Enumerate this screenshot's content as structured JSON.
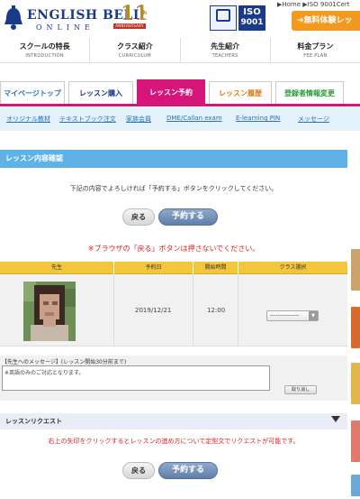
{
  "header": {
    "logo_text": "ENGLISH BELL",
    "logo_sub": "ONLINE",
    "anniversary_num": "11",
    "anniversary_suffix": "th",
    "anniversary_band": "ANNIVERSARY",
    "iso_label": "ISO",
    "iso_number": "9001",
    "top_links": "▶Home ▶ISO 9001Cert",
    "trial_button": "➔無料体験レッ"
  },
  "global_nav": [
    {
      "jp": "スクールの特長",
      "en": "INTRODUCTION"
    },
    {
      "jp": "クラス紹介",
      "en": "CURRICULUM"
    },
    {
      "jp": "先生紹介",
      "en": "TEACHERS"
    },
    {
      "jp": "料金プラン",
      "en": "FEE PLAN"
    }
  ],
  "tabs": [
    "マイページトップ",
    "レッスン購入",
    "レッスン予約",
    "レッスン履歴",
    "登録者情報変更"
  ],
  "sub_links": [
    "オリジナル教材",
    "テキストブック注文",
    "家族会員",
    "DME/Callan exam",
    "E-learning PIN",
    "メッセージ"
  ],
  "section_title": "レッスン内容確認",
  "confirm_message": "下記の内容でよろしければ「予約する」ボタンをクリックしてください。",
  "buttons": {
    "back": "戻る",
    "reserve": "予約する",
    "cancel": "取り消し"
  },
  "browser_back_warning": "※ブラウザの「戻る」ボタンは押さないでください。",
  "table": {
    "headers": [
      "先生",
      "予約日",
      "開始時間",
      "クラス選択"
    ],
    "row": {
      "date": "2019/12/21",
      "time": "12:00",
      "class_select": "---------------"
    }
  },
  "message": {
    "label": "【先生へのメッセージ】(レッスン開始30分前まで)",
    "value": "※英語のみのご対応となります。"
  },
  "request": {
    "title": "レッスンリクエスト",
    "note": "右上の矢印をクリックするとレッスンの進め方について定型文でリクエストが可能です。"
  },
  "colors": {
    "accent_pink": "#d6157a",
    "header_blue": "#5fb2e6",
    "table_yellow": "#f4c73a",
    "warning_red": "#e02020"
  }
}
